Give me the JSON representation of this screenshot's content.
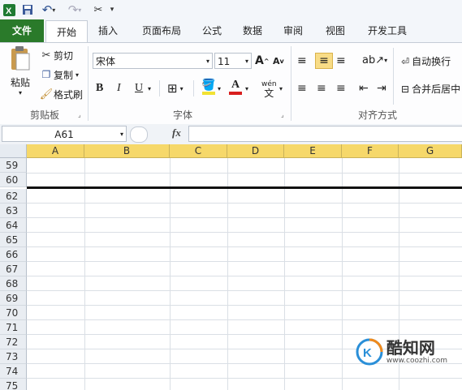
{
  "qat": {
    "excel_icon": "excel-logo-icon",
    "save_icon": "save-icon",
    "undo_icon": "undo-icon",
    "redo_icon": "redo-icon",
    "customize_icon": "customize-qat-icon"
  },
  "tabs": [
    {
      "label": "文件"
    },
    {
      "label": "开始"
    },
    {
      "label": "插入"
    },
    {
      "label": "页面布局"
    },
    {
      "label": "公式"
    },
    {
      "label": "数据"
    },
    {
      "label": "审阅"
    },
    {
      "label": "视图"
    },
    {
      "label": "开发工具"
    }
  ],
  "clipboard": {
    "paste": "粘贴",
    "cut": "剪切",
    "copy": "复制",
    "format_painter": "格式刷",
    "group": "剪贴板"
  },
  "font": {
    "name": "宋体",
    "size": "11",
    "group": "字体",
    "bold": "B",
    "italic": "I",
    "underline": "U",
    "phonetic": "wén"
  },
  "alignment": {
    "wrap": "自动换行",
    "merge": "合并后居中",
    "group": "对齐方式"
  },
  "formula_bar": {
    "name_box": "A61",
    "fx": "fx",
    "formula": ""
  },
  "columns": [
    "A",
    "B",
    "C",
    "D",
    "E",
    "F",
    "G"
  ],
  "rows": [
    "59",
    "60",
    "62",
    "63",
    "64",
    "65",
    "66",
    "67",
    "68",
    "69",
    "70",
    "71",
    "72",
    "73",
    "74",
    "75"
  ],
  "watermark": {
    "name": "酷知网",
    "url": "www.coozhi.com"
  },
  "colors": {
    "file_tab": "#2a7a2a",
    "column_header": "#f6d86a",
    "hidden_row_border": "#111111"
  }
}
